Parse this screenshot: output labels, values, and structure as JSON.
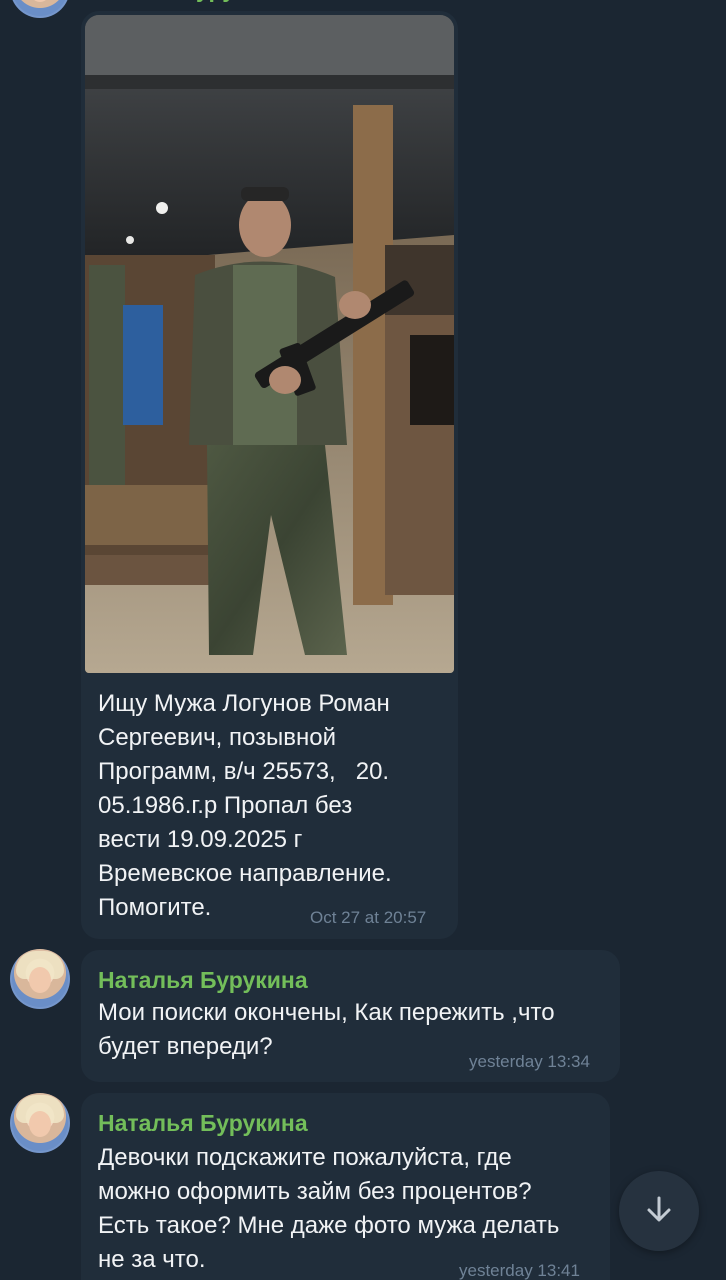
{
  "messages": [
    {
      "type": "photo",
      "photo_alt": "man in camouflage holding a rifle",
      "text": "Ищу Мужа Логунов Роман\nСергеевич, позывной\nПрограмм, в/ч 25573,   20.\n05.1986.г.р Пропал без\nвести 19.09.2025 г\nВремевское направление.\nПомогите.",
      "time": "Oct 27 at 20:57"
    },
    {
      "type": "text",
      "sender": "Наталья Бурукина",
      "text": "Мои поиски окончены, Как пережить ,что\nбудет впереди?",
      "time": "yesterday 13:34"
    },
    {
      "type": "text",
      "sender": "Наталья Бурукина",
      "text": "Девочки подскажите пожалуйста, где\nможно оформить займ без процентов?\nЕсть такое? Мне даже фото мужа делать\nне за что.",
      "time": "yesterday 13:41"
    }
  ],
  "icons": {
    "scroll_down": "arrow-down-icon"
  },
  "colors": {
    "background": "#1b2632",
    "bubble": "#202d3a",
    "sender_name": "#73be5a",
    "timestamp": "#6f8296"
  }
}
